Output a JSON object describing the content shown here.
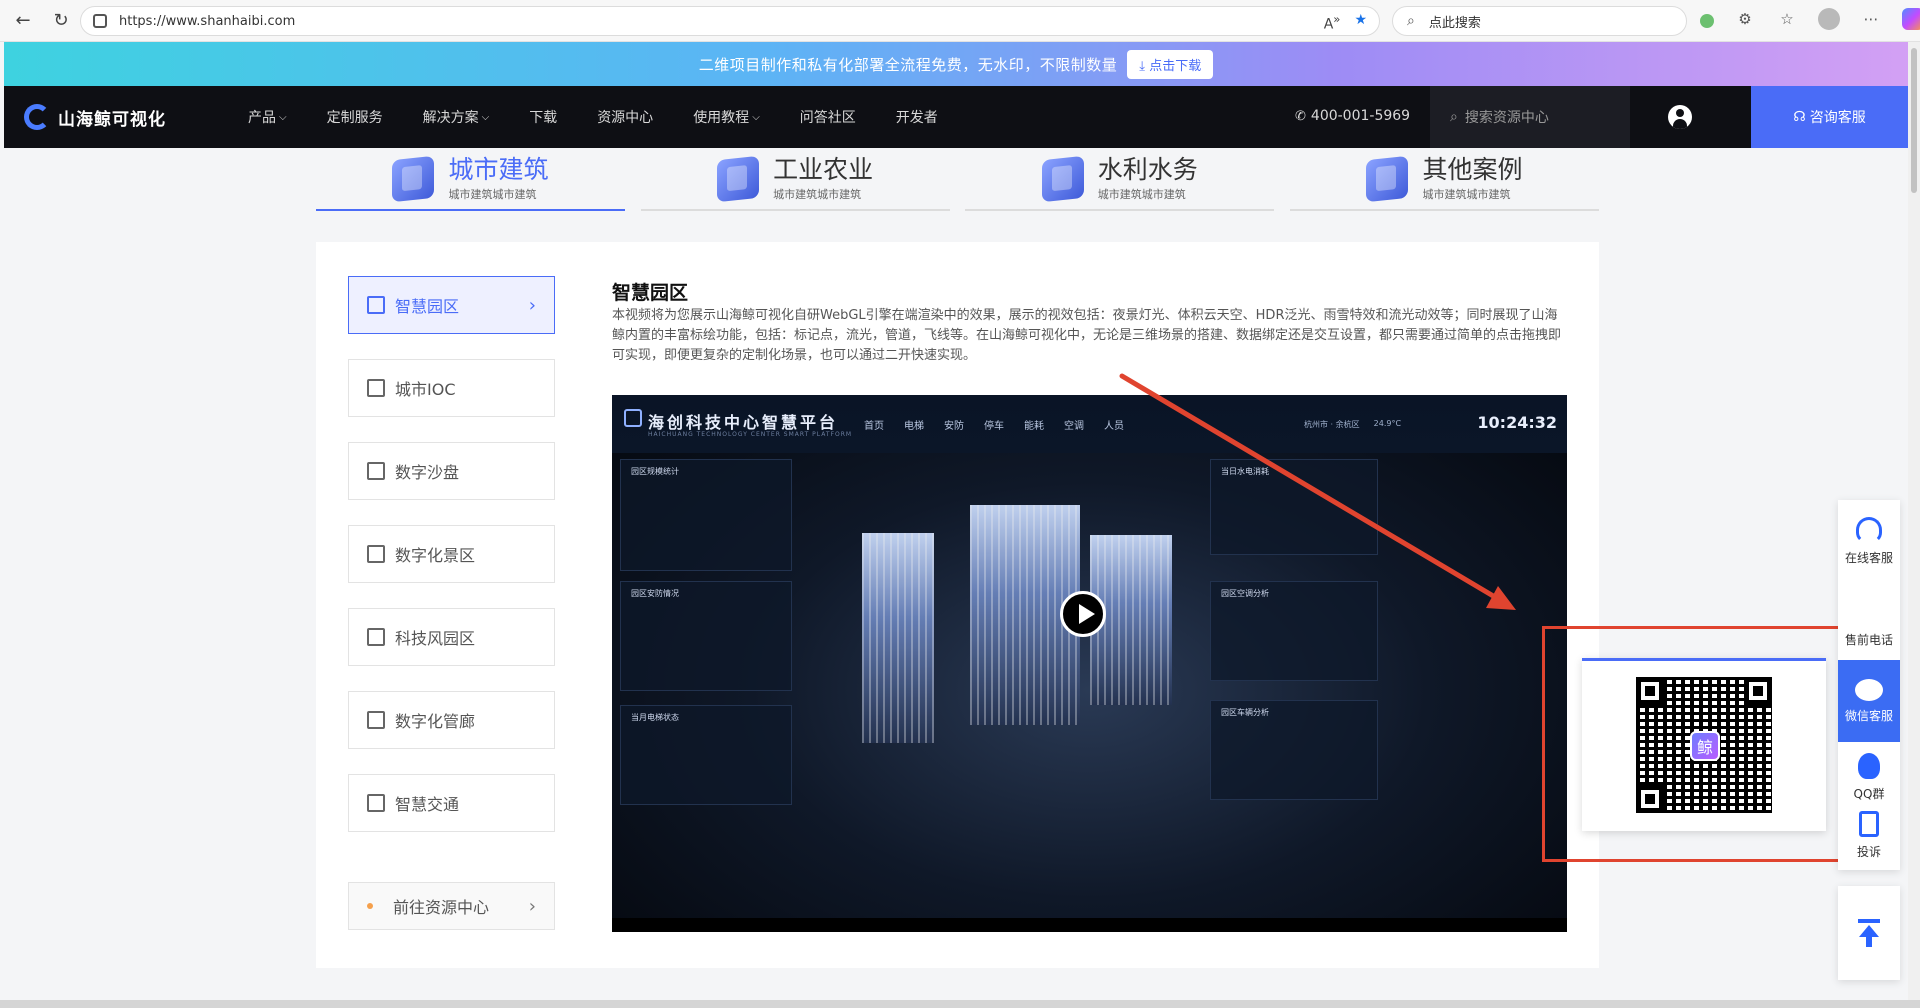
{
  "browser": {
    "url": "https://www.shanhaibi.com",
    "search_placeholder": "点此搜索"
  },
  "promo": {
    "text": "二维项目制作和私有化部署全流程免费，无水印，不限制数量",
    "button": "点击下载"
  },
  "header": {
    "logo": "山海鲸可视化",
    "nav": [
      "产品",
      "定制服务",
      "解决方案",
      "下载",
      "资源中心",
      "使用教程",
      "问答社区",
      "开发者"
    ],
    "phone": "400-001-5969",
    "search": "搜索资源中心",
    "consult": "咨询客服"
  },
  "category_tabs": [
    {
      "title": "城市建筑",
      "sub": "城市建筑城市建筑",
      "active": true
    },
    {
      "title": "工业农业",
      "sub": "城市建筑城市建筑",
      "active": false
    },
    {
      "title": "水利水务",
      "sub": "城市建筑城市建筑",
      "active": false
    },
    {
      "title": "其他案例",
      "sub": "城市建筑城市建筑",
      "active": false
    }
  ],
  "sidebar": {
    "items": [
      "智慧园区",
      "城市IOC",
      "数字沙盘",
      "数字化景区",
      "科技风园区",
      "数字化管廊",
      "智慧交通"
    ],
    "resource_link": "前往资源中心"
  },
  "content": {
    "title": "智慧园区",
    "description": "本视频将为您展示山海鲸可视化自研WebGL引擎在端渲染中的效果，展示的视效包括：夜景灯光、体积云天空、HDR泛光、雨雪特效和流光动效等；同时展现了山海鲸内置的丰富标绘功能，包括：标记点，流光，管道，飞线等。在山海鲸可视化中，无论是三维场景的搭建、数据绑定还是交互设置，都只需要通过简单的点击拖拽即可实现，即便更复杂的定制化场景，也可以通过二开快速实现。"
  },
  "video": {
    "title": "海创科技中心智慧平台",
    "subtitle": "HAICHUANG TECHNOLOGY CENTER SMART PLATFORM",
    "menu": [
      "首页",
      "电梯",
      "安防",
      "停车",
      "能耗",
      "空调",
      "人员"
    ],
    "location": "杭州市 · 余杭区",
    "temp": "24.9°C",
    "time": "10:24:32",
    "panels": {
      "p1": "园区规模统计",
      "p2": "园区安防情况",
      "p3": "当月电梯状态",
      "p4": "当日水电消耗",
      "p5": "园区空调分析",
      "p6": "园区车辆分析"
    }
  },
  "float_bar": {
    "items": [
      "在线客服",
      "售前电话",
      "微信客服",
      "QQ群",
      "投诉"
    ]
  },
  "qr": {
    "center_char": "鲸"
  }
}
